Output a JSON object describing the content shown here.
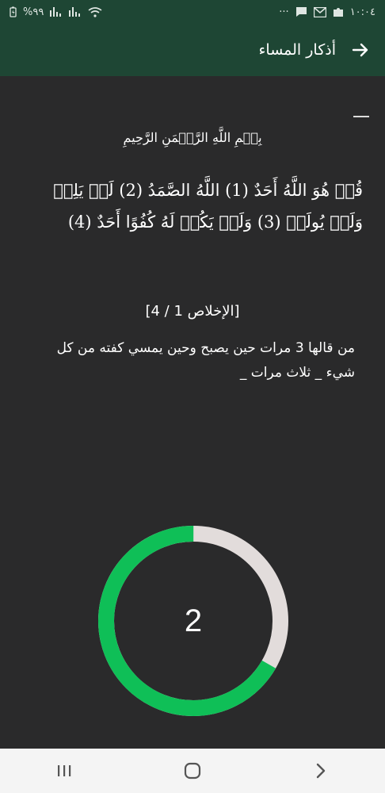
{
  "status_bar": {
    "time": "١٠:٠٤",
    "battery": "%٩٩",
    "dots": "···",
    "icons": [
      "battery-icon",
      "signal-icon",
      "signal-icon",
      "wifi-icon",
      "chat-icon",
      "gmail-icon",
      "puzzle-icon"
    ]
  },
  "header": {
    "title": "أذكار المساء",
    "back_icon": "arrow-right-icon"
  },
  "zikr": {
    "basmala": "بِسۡمِ اللَّهِ الرَّحۡمَنِ الرَّحِيمِ",
    "verse": "قُلۡ هُوَ اللَّهُ أَحَدٌ (1) اللَّهُ الصَّمَدُ (2) لَمۡ يَلِدۡ وَلَمۡ يُولَدۡ (3) وَلَمۡ يَكُنۡ لَهُ كُفُوًا أَحَدٌ (4)",
    "reference": "[الإخلاص 1 / 4]",
    "virtue": "من قالها 3 مرات حين يصبح وحين يمسي كفته من كل شيء _ ثلاث مرات _"
  },
  "counter": {
    "value": "2",
    "progress_fraction": 0.667,
    "progress_color": "#0fbf57",
    "track_color": "#e2dcdb"
  },
  "nav": {
    "icons": [
      "recent-apps-icon",
      "home-icon",
      "back-icon"
    ]
  }
}
